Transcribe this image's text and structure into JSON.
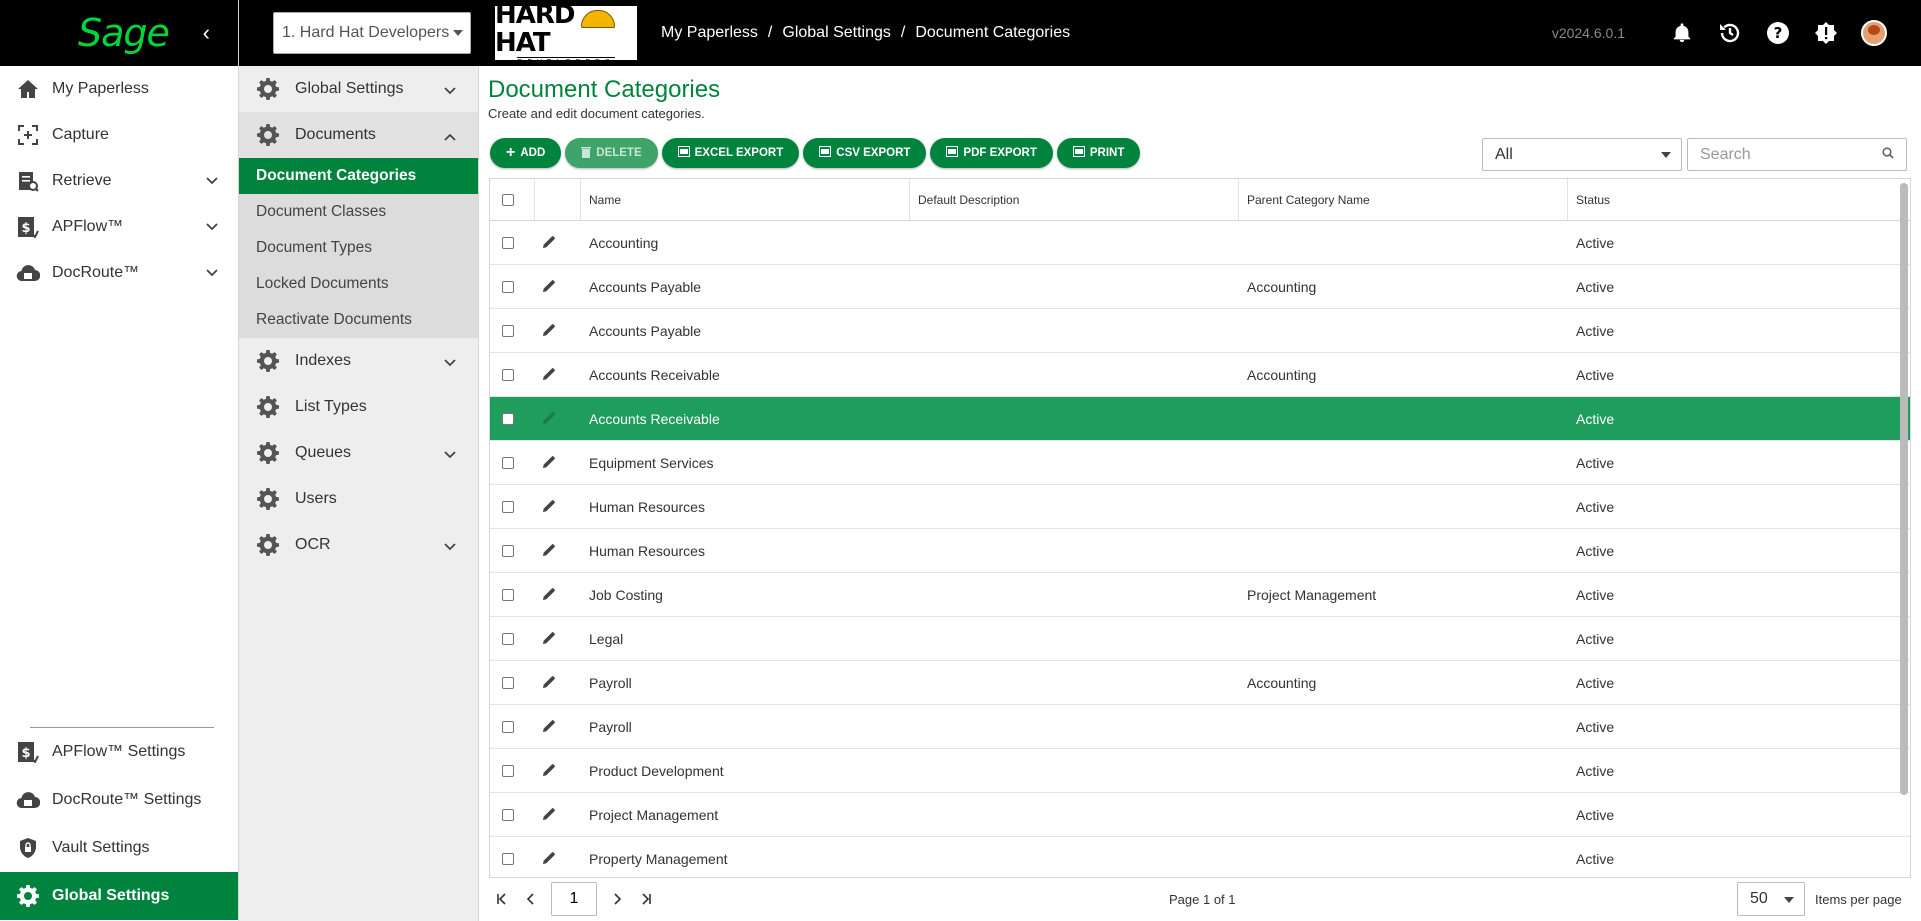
{
  "brand": {
    "logo_text": "Sage",
    "collapse_glyph": "‹"
  },
  "left_nav": {
    "top_items": [
      {
        "label": "My Paperless",
        "icon": "home-icon"
      },
      {
        "label": "Capture",
        "icon": "capture-icon"
      },
      {
        "label": "Retrieve",
        "icon": "retrieve-icon",
        "expandable": true
      },
      {
        "label": "APFlow™",
        "icon": "dollar-doc-icon",
        "expandable": true
      },
      {
        "label": "DocRoute™",
        "icon": "cloud-icon",
        "expandable": true
      }
    ],
    "bottom_items": [
      {
        "label": "APFlow™ Settings",
        "icon": "dollar-doc-icon"
      },
      {
        "label": "DocRoute™ Settings",
        "icon": "cloud-icon"
      },
      {
        "label": "Vault Settings",
        "icon": "shield-lock-icon"
      },
      {
        "label": "Global Settings",
        "icon": "gear-icon",
        "active": true
      }
    ]
  },
  "header": {
    "company": "1. Hard Hat Developers",
    "partner_logo": {
      "word": "HARD HAT",
      "sub": "DEVELOPERS"
    },
    "breadcrumb": [
      "My Paperless",
      "Global Settings",
      "Document Categories"
    ],
    "version": "v2024.6.0.1",
    "icons": [
      "bell-icon",
      "history-icon",
      "help-icon",
      "alert-icon"
    ]
  },
  "sub_nav": {
    "sections": [
      {
        "label": "Global Settings",
        "chevron": "down"
      },
      {
        "label": "Documents",
        "chevron": "up",
        "open": true,
        "children": [
          "Document Categories",
          "Document Classes",
          "Document Types",
          "Locked Documents",
          "Reactivate Documents"
        ],
        "active_child": "Document Categories"
      },
      {
        "label": "Indexes",
        "chevron": "down"
      },
      {
        "label": "List Types"
      },
      {
        "label": "Queues",
        "chevron": "down"
      },
      {
        "label": "Users"
      },
      {
        "label": "OCR",
        "chevron": "down"
      }
    ]
  },
  "page": {
    "title": "Document Categories",
    "subtitle": "Create and edit document categories."
  },
  "toolbar": {
    "add": "ADD",
    "delete": "DELETE",
    "excel": "EXCEL EXPORT",
    "csv": "CSV EXPORT",
    "pdf": "PDF EXPORT",
    "print": "PRINT"
  },
  "filter": {
    "value": "All"
  },
  "search": {
    "placeholder": "Search"
  },
  "table": {
    "columns": [
      "Name",
      "Default Description",
      "Parent Category Name",
      "Status"
    ],
    "rows": [
      {
        "name": "Accounting",
        "desc": "",
        "parent": "",
        "status": "Active"
      },
      {
        "name": "Accounts Payable",
        "desc": "",
        "parent": "Accounting",
        "status": "Active"
      },
      {
        "name": "Accounts Payable",
        "desc": "",
        "parent": "",
        "status": "Active"
      },
      {
        "name": "Accounts Receivable",
        "desc": "",
        "parent": "Accounting",
        "status": "Active"
      },
      {
        "name": "Accounts Receivable",
        "desc": "",
        "parent": "",
        "status": "Active",
        "selected": true
      },
      {
        "name": "Equipment Services",
        "desc": "",
        "parent": "",
        "status": "Active"
      },
      {
        "name": "Human Resources",
        "desc": "",
        "parent": "",
        "status": "Active"
      },
      {
        "name": "Human Resources",
        "desc": "",
        "parent": "",
        "status": "Active"
      },
      {
        "name": "Job Costing",
        "desc": "",
        "parent": "Project Management",
        "status": "Active"
      },
      {
        "name": "Legal",
        "desc": "",
        "parent": "",
        "status": "Active"
      },
      {
        "name": "Payroll",
        "desc": "",
        "parent": "Accounting",
        "status": "Active"
      },
      {
        "name": "Payroll",
        "desc": "",
        "parent": "",
        "status": "Active"
      },
      {
        "name": "Product Development",
        "desc": "",
        "parent": "",
        "status": "Active"
      },
      {
        "name": "Project Management",
        "desc": "",
        "parent": "",
        "status": "Active"
      },
      {
        "name": "Property Management",
        "desc": "",
        "parent": "",
        "status": "Active"
      }
    ]
  },
  "pager": {
    "current_page": "1",
    "info": "Page 1 of 1",
    "per_page": "50",
    "per_page_label": "Items per page"
  },
  "colors": {
    "accent": "#00843d",
    "selected_row": "#1f9d5c",
    "header_bg": "#000000",
    "logo_green": "#00d639"
  }
}
